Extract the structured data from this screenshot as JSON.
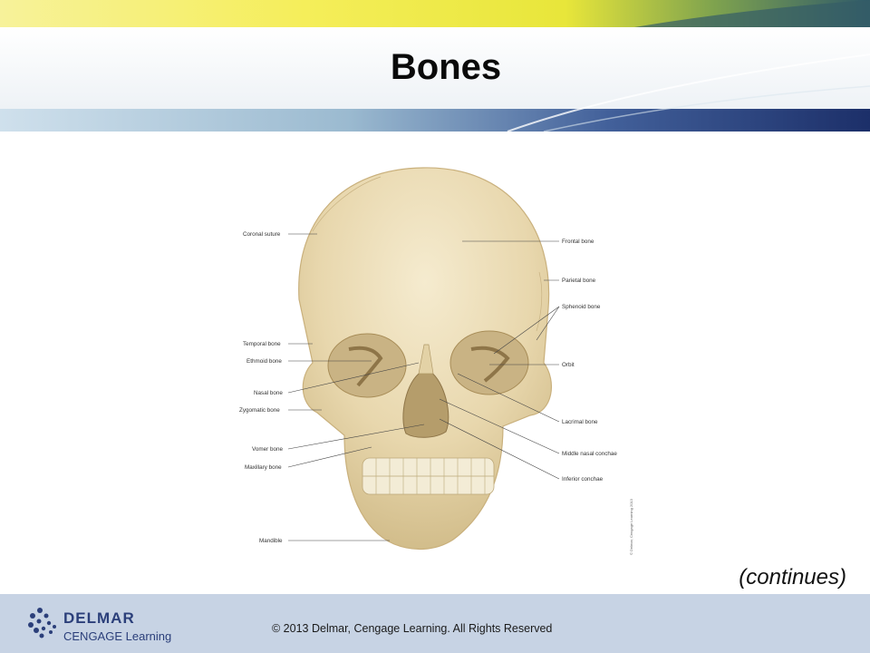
{
  "title": "Bones",
  "figure": {
    "labels_left": [
      "Coronal suture",
      "Temporal bone",
      "Ethmoid bone",
      "Nasal bone",
      "Zygomatic bone",
      "Vomer bone",
      "Maxillary bone",
      "Mandible"
    ],
    "labels_right": [
      "Frontal bone",
      "Parietal bone",
      "Sphenoid bone",
      "Orbit",
      "Lacrimal bone",
      "Middle nasal conchae",
      "Inferior conchae"
    ],
    "credit": "© Delmar, Cengage Learning 2013"
  },
  "continues": "(continues)",
  "footer": {
    "logo_top": "DELMAR",
    "logo_bottom": "CENGAGE Learning",
    "copyright": "© 2013 Delmar, Cengage Learning. All Rights Reserved"
  },
  "colors": {
    "footer_bg": "#c7d3e4",
    "bone": "#e9d9b2",
    "banner_dark": "#2a3f78",
    "banner_yellow": "#f2ee3a"
  }
}
